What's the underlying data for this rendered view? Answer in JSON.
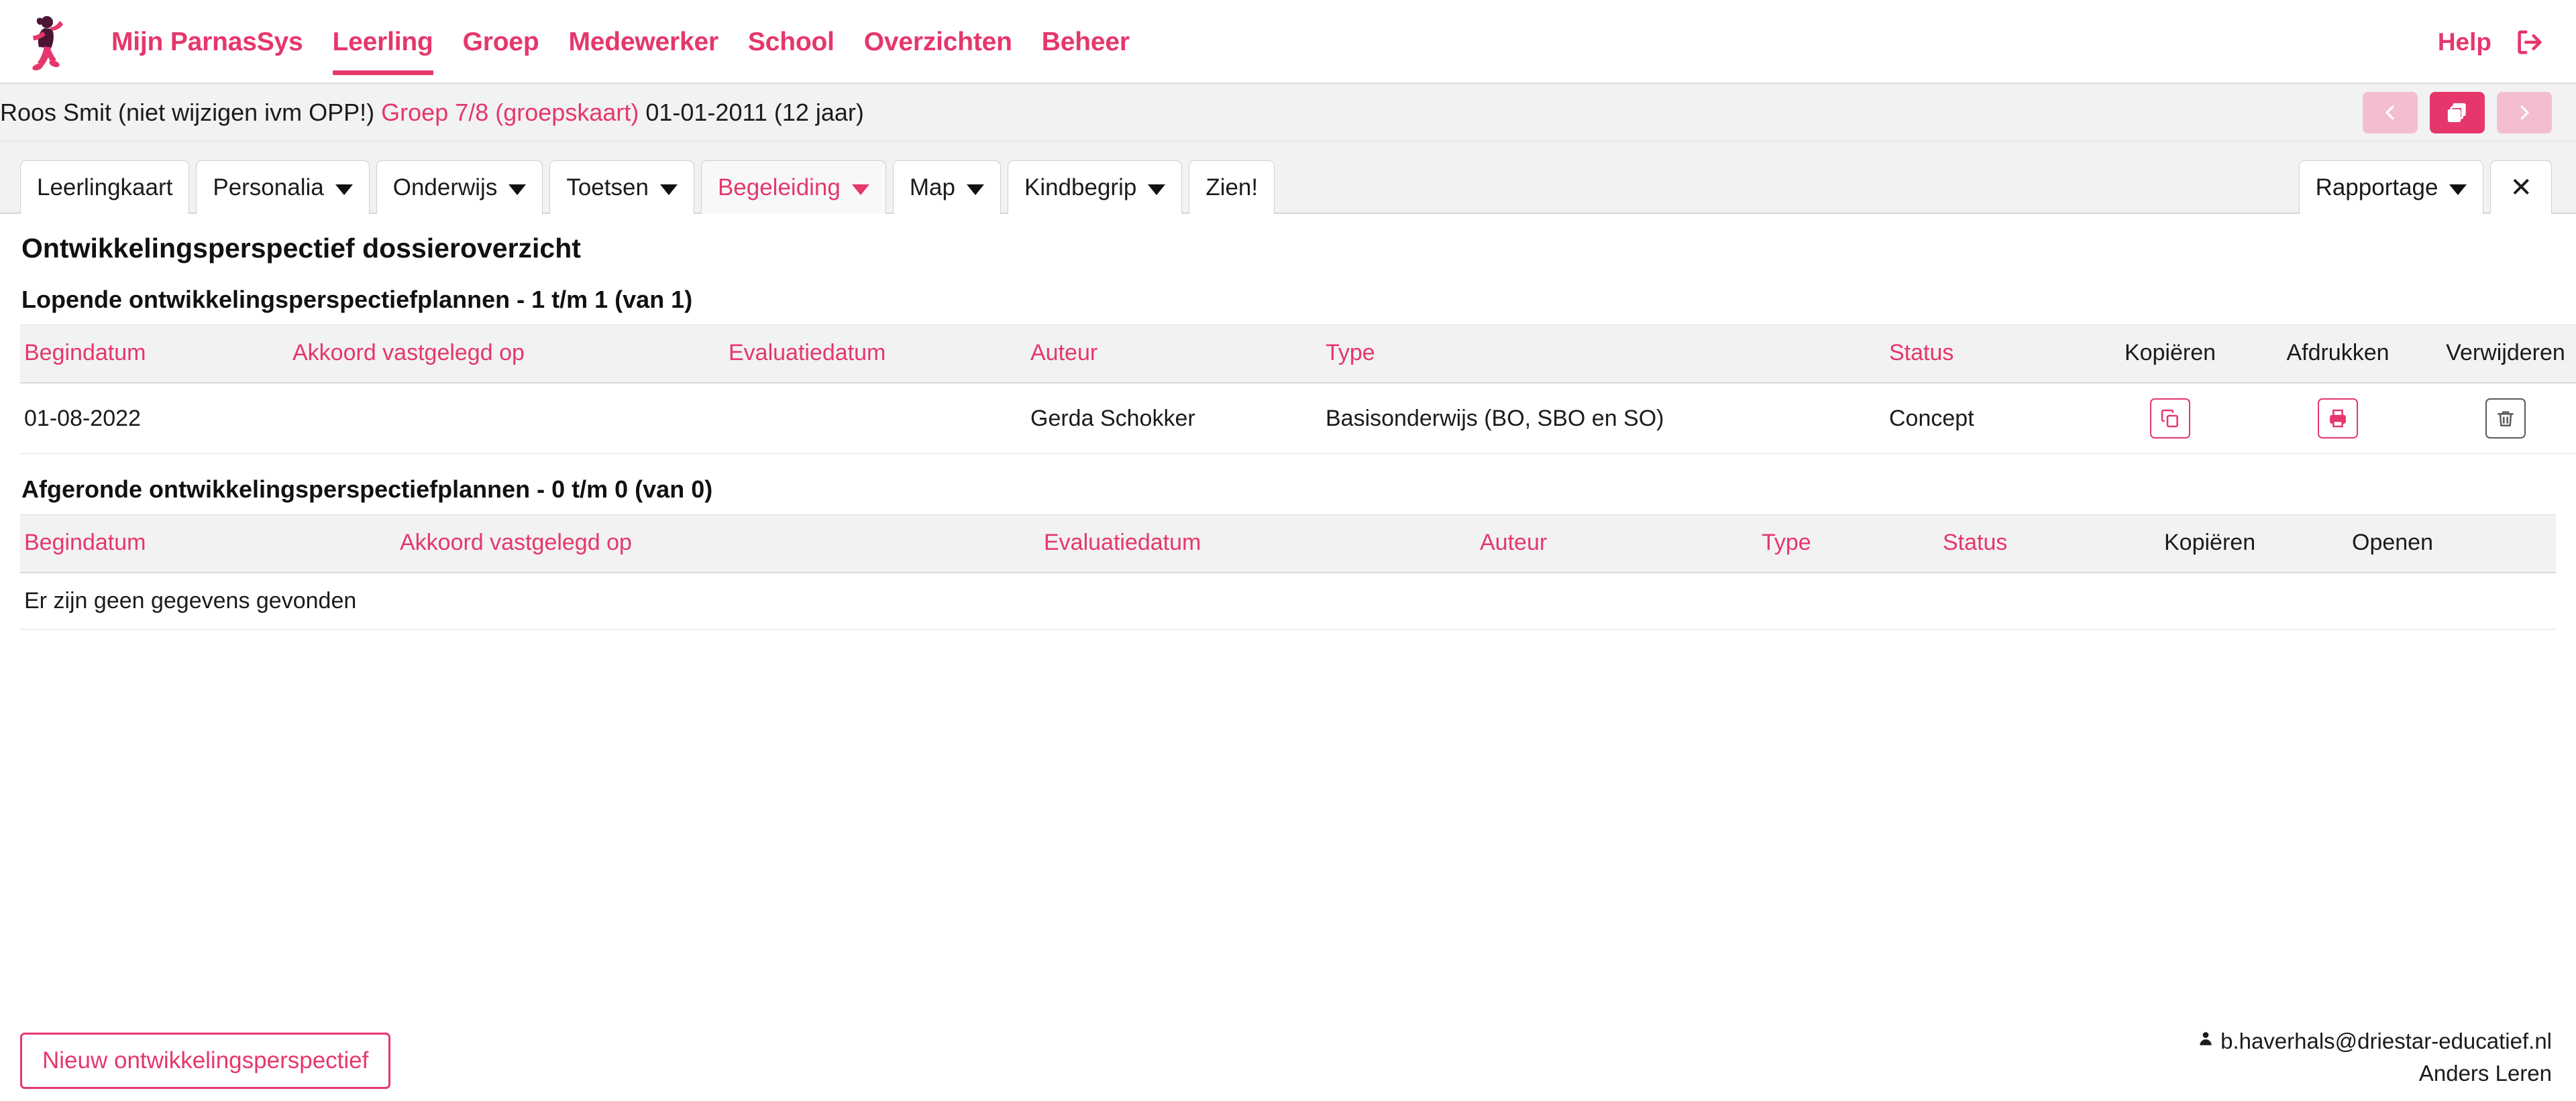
{
  "brand": {
    "accent": "#e5376c",
    "accent_light": "#f3bfd0",
    "logo_icon": "running-girl-logo"
  },
  "topnav": {
    "items": [
      {
        "label": "Mijn ParnasSys",
        "active": false
      },
      {
        "label": "Leerling",
        "active": true
      },
      {
        "label": "Groep",
        "active": false
      },
      {
        "label": "Medewerker",
        "active": false
      },
      {
        "label": "School",
        "active": false
      },
      {
        "label": "Overzichten",
        "active": false
      },
      {
        "label": "Beheer",
        "active": false
      }
    ],
    "help_label": "Help",
    "logout_icon": "logout-icon"
  },
  "student_bar": {
    "name": "Roos Smit (niet wijzigen ivm OPP!)",
    "group": "Groep 7/8 (groepskaart)",
    "birthdate_age": "01-01-2011 (12 jaar)",
    "nav": {
      "prev_icon": "chevron-left-icon",
      "cards_icon": "stacked-cards-icon",
      "next_icon": "chevron-right-icon"
    }
  },
  "tabs": {
    "left": [
      {
        "label": "Leerlingkaart",
        "caret": false,
        "active": false
      },
      {
        "label": "Personalia",
        "caret": true,
        "active": false
      },
      {
        "label": "Onderwijs",
        "caret": true,
        "active": false
      },
      {
        "label": "Toetsen",
        "caret": true,
        "active": false
      },
      {
        "label": "Begeleiding",
        "caret": true,
        "active": true
      },
      {
        "label": "Map",
        "caret": true,
        "active": false
      },
      {
        "label": "Kindbegrip",
        "caret": true,
        "active": false
      },
      {
        "label": "Zien!",
        "caret": false,
        "active": false
      }
    ],
    "right": [
      {
        "label": "Rapportage",
        "caret": true,
        "active": false
      },
      {
        "label": "✕",
        "caret": false,
        "active": false,
        "name": "close-tab"
      }
    ]
  },
  "main": {
    "page_title": "Ontwikkelingsperspectief dossieroverzicht",
    "section_running": {
      "heading": "Lopende ontwikkelingsperspectiefplannen - 1 t/m 1 (van 1)",
      "columns": [
        {
          "label": "Begindatum",
          "sortable": true,
          "align": "left"
        },
        {
          "label": "Akkoord vastgelegd op",
          "sortable": true,
          "align": "left"
        },
        {
          "label": "Evaluatiedatum",
          "sortable": true,
          "align": "left"
        },
        {
          "label": "Auteur",
          "sortable": true,
          "align": "left"
        },
        {
          "label": "Type",
          "sortable": true,
          "align": "left"
        },
        {
          "label": "Status",
          "sortable": true,
          "align": "left"
        },
        {
          "label": "Kopiëren",
          "sortable": false,
          "align": "center"
        },
        {
          "label": "Afdrukken",
          "sortable": false,
          "align": "center"
        },
        {
          "label": "Verwijderen",
          "sortable": false,
          "align": "center"
        }
      ],
      "rows": [
        {
          "begindatum": "01-08-2022",
          "akkoord": "",
          "evaluatiedatum": "",
          "auteur": "Gerda Schokker",
          "type": "Basisonderwijs (BO, SBO en SO)",
          "status": "Concept",
          "kopieren_icon": "copy-icon",
          "afdrukken_icon": "print-icon",
          "verwijderen_icon": "trash-icon"
        }
      ]
    },
    "section_completed": {
      "heading": "Afgeronde ontwikkelingsperspectiefplannen - 0 t/m 0 (van 0)",
      "columns": [
        {
          "label": "Begindatum",
          "sortable": true,
          "align": "left"
        },
        {
          "label": "Akkoord vastgelegd op",
          "sortable": true,
          "align": "left"
        },
        {
          "label": "Evaluatiedatum",
          "sortable": true,
          "align": "left"
        },
        {
          "label": "Auteur",
          "sortable": true,
          "align": "left"
        },
        {
          "label": "Type",
          "sortable": true,
          "align": "left"
        },
        {
          "label": "Status",
          "sortable": true,
          "align": "left"
        },
        {
          "label": "Kopiëren",
          "sortable": false,
          "align": "center"
        },
        {
          "label": "Openen",
          "sortable": false,
          "align": "center"
        }
      ],
      "empty_message": "Er zijn geen gegevens gevonden"
    }
  },
  "footer": {
    "new_button_label": "Nieuw ontwikkelingsperspectief",
    "user_icon": "user-icon",
    "user_email": "b.haverhals@driestar-educatief.nl",
    "organisation": "Anders Leren"
  }
}
